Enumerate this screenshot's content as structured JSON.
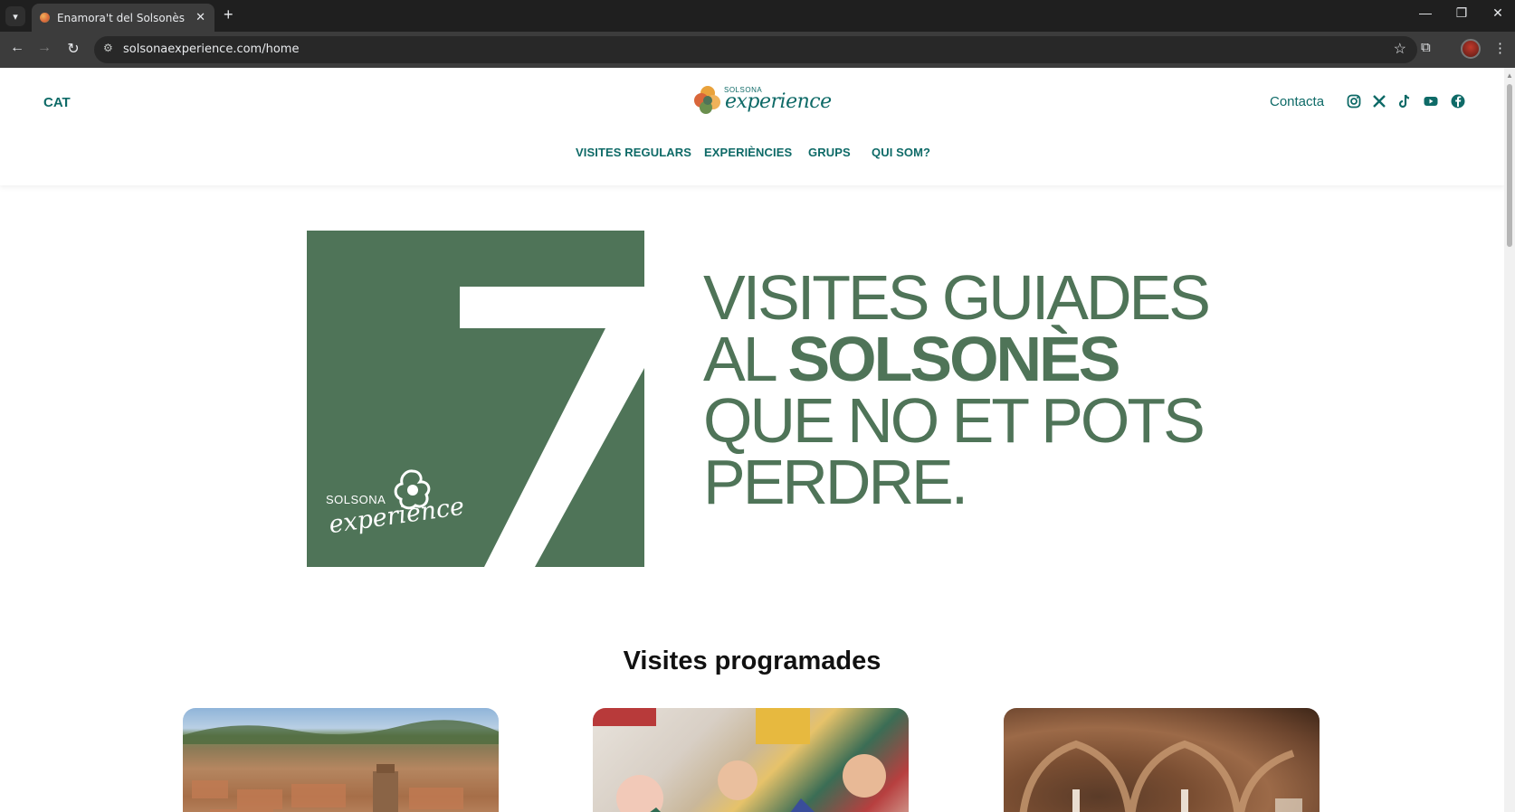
{
  "browser": {
    "tab_title": "Enamora't del Solsonès",
    "new_tab": "+",
    "tab_close": "✕",
    "url": "solsonaexperience.com/home",
    "window_controls": [
      "—",
      "❐",
      "✕"
    ]
  },
  "header": {
    "language": "CAT",
    "logo_small": "SOLSONA",
    "logo_script": "experience",
    "contact": "Contacta",
    "social_icons": [
      "instagram-icon",
      "x-icon",
      "tiktok-icon",
      "youtube-icon",
      "facebook-icon"
    ]
  },
  "nav": {
    "items": [
      "VISITES REGULARS",
      "EXPERIÈNCIES",
      "GRUPS",
      "QUI SOM?"
    ]
  },
  "hero": {
    "brand_small": "SOLSONA",
    "brand_script": "experience",
    "line1": "VISITES GUIADES",
    "line2_normal": "AL ",
    "line2_bold": "SOLSONÈS",
    "line3": "QUE NO ET POTS",
    "line4": "PERDRE."
  },
  "section": {
    "title": "Visites programades"
  },
  "colors": {
    "brand_teal": "#0e6a67",
    "brand_green": "#4f7458"
  }
}
